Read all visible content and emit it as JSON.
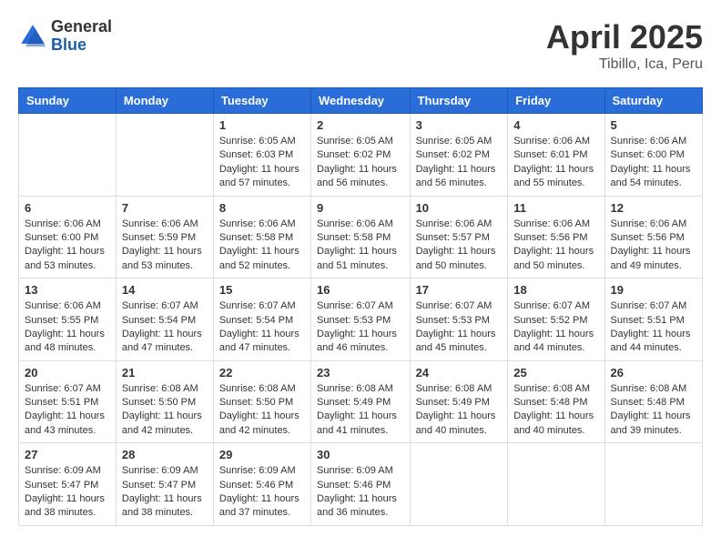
{
  "header": {
    "logo_general": "General",
    "logo_blue": "Blue",
    "title": "April 2025",
    "subtitle": "Tibillo, Ica, Peru"
  },
  "weekdays": [
    "Sunday",
    "Monday",
    "Tuesday",
    "Wednesday",
    "Thursday",
    "Friday",
    "Saturday"
  ],
  "weeks": [
    [
      {
        "day": "",
        "sunrise": "",
        "sunset": "",
        "daylight": ""
      },
      {
        "day": "",
        "sunrise": "",
        "sunset": "",
        "daylight": ""
      },
      {
        "day": "1",
        "sunrise": "Sunrise: 6:05 AM",
        "sunset": "Sunset: 6:03 PM",
        "daylight": "Daylight: 11 hours and 57 minutes."
      },
      {
        "day": "2",
        "sunrise": "Sunrise: 6:05 AM",
        "sunset": "Sunset: 6:02 PM",
        "daylight": "Daylight: 11 hours and 56 minutes."
      },
      {
        "day": "3",
        "sunrise": "Sunrise: 6:05 AM",
        "sunset": "Sunset: 6:02 PM",
        "daylight": "Daylight: 11 hours and 56 minutes."
      },
      {
        "day": "4",
        "sunrise": "Sunrise: 6:06 AM",
        "sunset": "Sunset: 6:01 PM",
        "daylight": "Daylight: 11 hours and 55 minutes."
      },
      {
        "day": "5",
        "sunrise": "Sunrise: 6:06 AM",
        "sunset": "Sunset: 6:00 PM",
        "daylight": "Daylight: 11 hours and 54 minutes."
      }
    ],
    [
      {
        "day": "6",
        "sunrise": "Sunrise: 6:06 AM",
        "sunset": "Sunset: 6:00 PM",
        "daylight": "Daylight: 11 hours and 53 minutes."
      },
      {
        "day": "7",
        "sunrise": "Sunrise: 6:06 AM",
        "sunset": "Sunset: 5:59 PM",
        "daylight": "Daylight: 11 hours and 53 minutes."
      },
      {
        "day": "8",
        "sunrise": "Sunrise: 6:06 AM",
        "sunset": "Sunset: 5:58 PM",
        "daylight": "Daylight: 11 hours and 52 minutes."
      },
      {
        "day": "9",
        "sunrise": "Sunrise: 6:06 AM",
        "sunset": "Sunset: 5:58 PM",
        "daylight": "Daylight: 11 hours and 51 minutes."
      },
      {
        "day": "10",
        "sunrise": "Sunrise: 6:06 AM",
        "sunset": "Sunset: 5:57 PM",
        "daylight": "Daylight: 11 hours and 50 minutes."
      },
      {
        "day": "11",
        "sunrise": "Sunrise: 6:06 AM",
        "sunset": "Sunset: 5:56 PM",
        "daylight": "Daylight: 11 hours and 50 minutes."
      },
      {
        "day": "12",
        "sunrise": "Sunrise: 6:06 AM",
        "sunset": "Sunset: 5:56 PM",
        "daylight": "Daylight: 11 hours and 49 minutes."
      }
    ],
    [
      {
        "day": "13",
        "sunrise": "Sunrise: 6:06 AM",
        "sunset": "Sunset: 5:55 PM",
        "daylight": "Daylight: 11 hours and 48 minutes."
      },
      {
        "day": "14",
        "sunrise": "Sunrise: 6:07 AM",
        "sunset": "Sunset: 5:54 PM",
        "daylight": "Daylight: 11 hours and 47 minutes."
      },
      {
        "day": "15",
        "sunrise": "Sunrise: 6:07 AM",
        "sunset": "Sunset: 5:54 PM",
        "daylight": "Daylight: 11 hours and 47 minutes."
      },
      {
        "day": "16",
        "sunrise": "Sunrise: 6:07 AM",
        "sunset": "Sunset: 5:53 PM",
        "daylight": "Daylight: 11 hours and 46 minutes."
      },
      {
        "day": "17",
        "sunrise": "Sunrise: 6:07 AM",
        "sunset": "Sunset: 5:53 PM",
        "daylight": "Daylight: 11 hours and 45 minutes."
      },
      {
        "day": "18",
        "sunrise": "Sunrise: 6:07 AM",
        "sunset": "Sunset: 5:52 PM",
        "daylight": "Daylight: 11 hours and 44 minutes."
      },
      {
        "day": "19",
        "sunrise": "Sunrise: 6:07 AM",
        "sunset": "Sunset: 5:51 PM",
        "daylight": "Daylight: 11 hours and 44 minutes."
      }
    ],
    [
      {
        "day": "20",
        "sunrise": "Sunrise: 6:07 AM",
        "sunset": "Sunset: 5:51 PM",
        "daylight": "Daylight: 11 hours and 43 minutes."
      },
      {
        "day": "21",
        "sunrise": "Sunrise: 6:08 AM",
        "sunset": "Sunset: 5:50 PM",
        "daylight": "Daylight: 11 hours and 42 minutes."
      },
      {
        "day": "22",
        "sunrise": "Sunrise: 6:08 AM",
        "sunset": "Sunset: 5:50 PM",
        "daylight": "Daylight: 11 hours and 42 minutes."
      },
      {
        "day": "23",
        "sunrise": "Sunrise: 6:08 AM",
        "sunset": "Sunset: 5:49 PM",
        "daylight": "Daylight: 11 hours and 41 minutes."
      },
      {
        "day": "24",
        "sunrise": "Sunrise: 6:08 AM",
        "sunset": "Sunset: 5:49 PM",
        "daylight": "Daylight: 11 hours and 40 minutes."
      },
      {
        "day": "25",
        "sunrise": "Sunrise: 6:08 AM",
        "sunset": "Sunset: 5:48 PM",
        "daylight": "Daylight: 11 hours and 40 minutes."
      },
      {
        "day": "26",
        "sunrise": "Sunrise: 6:08 AM",
        "sunset": "Sunset: 5:48 PM",
        "daylight": "Daylight: 11 hours and 39 minutes."
      }
    ],
    [
      {
        "day": "27",
        "sunrise": "Sunrise: 6:09 AM",
        "sunset": "Sunset: 5:47 PM",
        "daylight": "Daylight: 11 hours and 38 minutes."
      },
      {
        "day": "28",
        "sunrise": "Sunrise: 6:09 AM",
        "sunset": "Sunset: 5:47 PM",
        "daylight": "Daylight: 11 hours and 38 minutes."
      },
      {
        "day": "29",
        "sunrise": "Sunrise: 6:09 AM",
        "sunset": "Sunset: 5:46 PM",
        "daylight": "Daylight: 11 hours and 37 minutes."
      },
      {
        "day": "30",
        "sunrise": "Sunrise: 6:09 AM",
        "sunset": "Sunset: 5:46 PM",
        "daylight": "Daylight: 11 hours and 36 minutes."
      },
      {
        "day": "",
        "sunrise": "",
        "sunset": "",
        "daylight": ""
      },
      {
        "day": "",
        "sunrise": "",
        "sunset": "",
        "daylight": ""
      },
      {
        "day": "",
        "sunrise": "",
        "sunset": "",
        "daylight": ""
      }
    ]
  ]
}
